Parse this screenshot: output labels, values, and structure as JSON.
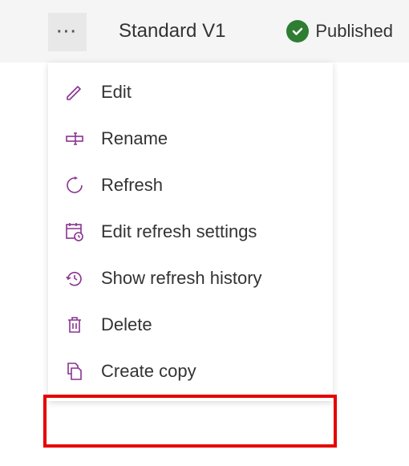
{
  "header": {
    "title": "Standard V1",
    "status_text": "Published"
  },
  "menu": {
    "items": [
      {
        "label": "Edit"
      },
      {
        "label": "Rename"
      },
      {
        "label": "Refresh"
      },
      {
        "label": "Edit refresh settings"
      },
      {
        "label": "Show refresh history"
      },
      {
        "label": "Delete"
      },
      {
        "label": "Create copy"
      }
    ]
  },
  "colors": {
    "icon_purple": "#8a3391",
    "status_green": "#2e7d32",
    "highlight_red": "#e60000"
  }
}
